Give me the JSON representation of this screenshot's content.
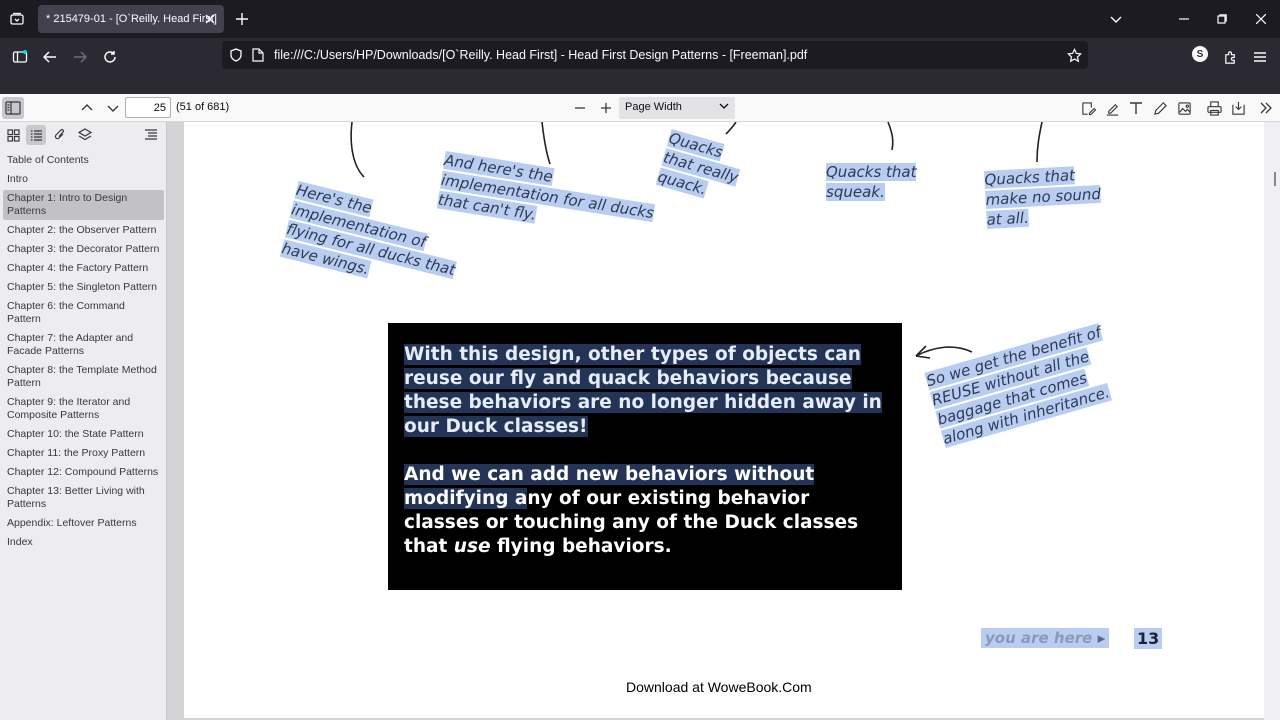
{
  "tab": {
    "title": "* 215479-01 - [O`Reilly. Head First]"
  },
  "url": "file:///C:/Users/HP/Downloads/[O`Reilly. Head First] - Head First Design Patterns - [Freeman].pdf",
  "profile_initial": "S",
  "pdf_toolbar": {
    "page_value": "25",
    "page_count": "(51 of 681)",
    "zoom": "Page Width"
  },
  "outline": [
    "Table of Contents",
    "Intro",
    "Chapter 1: Intro to Design Patterns",
    "Chapter 2: the Observer Pattern",
    "Chapter 3: the Decorator Pattern",
    "Chapter 4: the Factory Pattern",
    "Chapter 5: the Singleton Pattern",
    "Chapter 6: the Command Pattern",
    "Chapter 7: the Adapter and Facade Patterns",
    "Chapter 8: the Template Method Pattern",
    "Chapter 9: the Iterator and Composite Patterns",
    "Chapter 10: the State Pattern",
    "Chapter 11: the Proxy Pattern",
    "Chapter 12: Compound Patterns",
    "Chapter 13: Better Living with Patterns",
    "Appendix: Leftover Patterns",
    "Index"
  ],
  "page": {
    "note_fly_wings": "Here's the implementation of flying for all ducks that have wings.",
    "note_cant_fly": "And here's the implementation for all ducks that can't fly.",
    "note_quack": "Quacks that really quack.",
    "note_squeak": "Quacks that squeak.",
    "note_no_sound": "Quacks that make no sound at all.",
    "box_para1": "With this design, other types of objects can reuse our fly and quack behaviors because these behaviors are no longer hidden away in our Duck classes!",
    "box_para2_a": "And we can add new behaviors without modifying a",
    "box_para2_b": "ny of our existing behavior classes or touching any of the Duck classes that ",
    "box_para2_em": "use",
    "box_para2_c": " flying behaviors.",
    "note_reuse": "So we get the benefit of REUSE without all the baggage that comes along with inheritance.",
    "you_are_here": "you are here",
    "page_number": "13",
    "download": "Download at WoweBook.Com"
  }
}
